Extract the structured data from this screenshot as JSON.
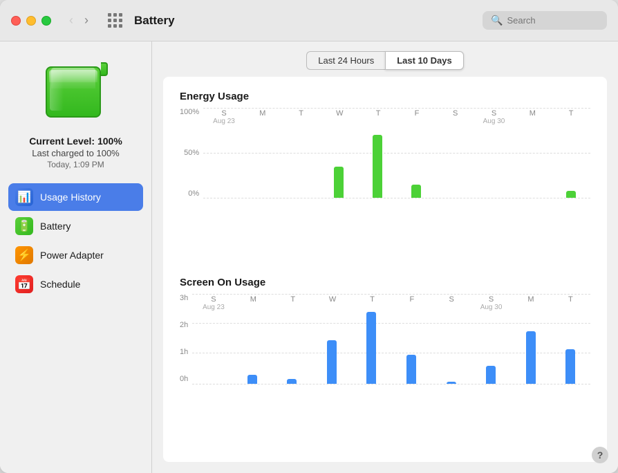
{
  "titlebar": {
    "title": "Battery",
    "search_placeholder": "Search",
    "back_label": "‹",
    "forward_label": "›"
  },
  "sidebar": {
    "battery_level": "Current Level: 100%",
    "charged_text": "Last charged to 100%",
    "time_text": "Today, 1:09 PM",
    "nav_items": [
      {
        "id": "usage-history",
        "label": "Usage History",
        "icon": "📊",
        "icon_class": "icon-usage",
        "active": true
      },
      {
        "id": "battery",
        "label": "Battery",
        "icon": "🔋",
        "icon_class": "icon-battery",
        "active": false
      },
      {
        "id": "power-adapter",
        "label": "Power Adapter",
        "icon": "⚡",
        "icon_class": "icon-power",
        "active": false
      },
      {
        "id": "schedule",
        "label": "Schedule",
        "icon": "📅",
        "icon_class": "icon-schedule",
        "active": false
      }
    ]
  },
  "tabs": [
    {
      "id": "24h",
      "label": "Last 24 Hours",
      "active": false
    },
    {
      "id": "10d",
      "label": "Last 10 Days",
      "active": true
    }
  ],
  "energy_chart": {
    "title": "Energy Usage",
    "y_labels": [
      "100%",
      "50%",
      "0%"
    ],
    "days": [
      {
        "day": "S",
        "date": "Aug 23",
        "height_pct": 0
      },
      {
        "day": "M",
        "date": "",
        "height_pct": 0
      },
      {
        "day": "T",
        "date": "",
        "height_pct": 0
      },
      {
        "day": "W",
        "date": "",
        "height_pct": 35
      },
      {
        "day": "T",
        "date": "",
        "height_pct": 70
      },
      {
        "day": "F",
        "date": "",
        "height_pct": 15
      },
      {
        "day": "S",
        "date": "",
        "height_pct": 0
      },
      {
        "day": "S",
        "date": "Aug 30",
        "height_pct": 0
      },
      {
        "day": "M",
        "date": "",
        "height_pct": 0
      },
      {
        "day": "T",
        "date": "",
        "height_pct": 8
      }
    ]
  },
  "screen_chart": {
    "title": "Screen On Usage",
    "y_labels": [
      "3h",
      "2h",
      "1h",
      "0h"
    ],
    "days": [
      {
        "day": "S",
        "date": "Aug 23",
        "height_pct": 0
      },
      {
        "day": "M",
        "date": "",
        "height_pct": 10
      },
      {
        "day": "T",
        "date": "",
        "height_pct": 5
      },
      {
        "day": "W",
        "date": "",
        "height_pct": 48
      },
      {
        "day": "T",
        "date": "",
        "height_pct": 80
      },
      {
        "day": "F",
        "date": "",
        "height_pct": 32
      },
      {
        "day": "S",
        "date": "",
        "height_pct": 2
      },
      {
        "day": "S",
        "date": "Aug 30",
        "height_pct": 20
      },
      {
        "day": "M",
        "date": "",
        "height_pct": 58
      },
      {
        "day": "T",
        "date": "",
        "height_pct": 38
      }
    ]
  },
  "help_label": "?"
}
